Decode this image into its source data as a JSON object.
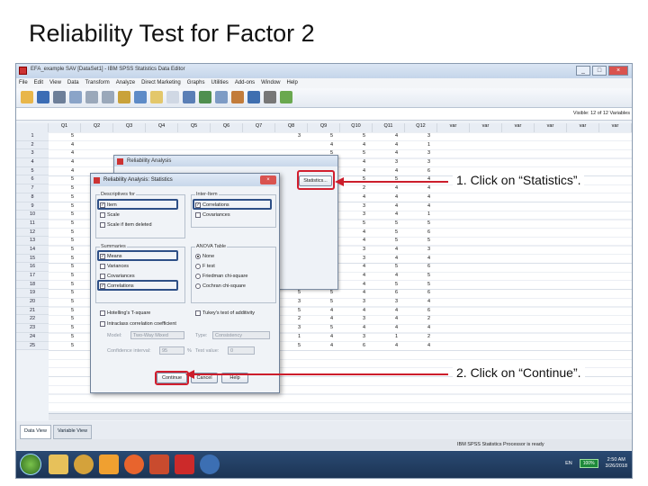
{
  "slide": {
    "title": "Reliability Test for Factor 2"
  },
  "window": {
    "title": "EFA_example SAV [DataSet1] - IBM SPSS Statistics Data Editor",
    "controls": [
      "_",
      "□",
      "×"
    ]
  },
  "menu": [
    "File",
    "Edit",
    "View",
    "Data",
    "Transform",
    "Analyze",
    "Direct Marketing",
    "Graphs",
    "Utilities",
    "Add-ons",
    "Window",
    "Help"
  ],
  "visible_vars": "Visible: 12 of 12 Variables",
  "columns": [
    "Q1",
    "Q2",
    "Q3",
    "Q4",
    "Q5",
    "Q6",
    "Q7",
    "Q8",
    "Q9",
    "Q10",
    "Q11",
    "Q12",
    "var",
    "var",
    "var",
    "var",
    "var",
    "var"
  ],
  "rows": [
    "1",
    "2",
    "3",
    "4",
    "5",
    "6",
    "7",
    "8",
    "9",
    "10",
    "11",
    "12",
    "13",
    "14",
    "15",
    "16",
    "17",
    "18",
    "19",
    "20",
    "21",
    "22",
    "23",
    "24",
    "25"
  ],
  "col_values": {
    "q1": [
      "5",
      "4",
      "4",
      "4",
      "4",
      "5",
      "5",
      "5",
      "5",
      "5",
      "5",
      "5",
      "5",
      "5",
      "5",
      "5",
      "5",
      "5",
      "5",
      "5",
      "5",
      "5",
      "5",
      "5",
      "5"
    ],
    "q9": [
      "5",
      "4",
      "5",
      "4",
      "4",
      "4",
      "5",
      "5",
      "5",
      "5",
      "5",
      "4",
      "5",
      "5",
      "5",
      "5",
      "4",
      "4",
      "5",
      "5",
      "4",
      "4",
      "5",
      "4",
      "4"
    ],
    "q10": [
      "5",
      "4",
      "5",
      "4",
      "4",
      "5",
      "2",
      "4",
      "3",
      "3",
      "5",
      "4",
      "4",
      "3",
      "3",
      "4",
      "4",
      "4",
      "4",
      "3",
      "4",
      "3",
      "4",
      "3",
      "6"
    ],
    "q11": [
      "4",
      "4",
      "4",
      "3",
      "4",
      "5",
      "4",
      "4",
      "4",
      "4",
      "5",
      "5",
      "5",
      "4",
      "4",
      "5",
      "4",
      "5",
      "6",
      "3",
      "4",
      "4",
      "4",
      "1",
      "4"
    ],
    "q12": [
      "3",
      "1",
      "3",
      "3",
      "6",
      "4",
      "4",
      "4",
      "4",
      "1",
      "5",
      "6",
      "5",
      "3",
      "4",
      "6",
      "5",
      "5",
      "6",
      "4",
      "6",
      "2",
      "4",
      "2",
      "4"
    ],
    "q8": [
      "3",
      "",
      "",
      "",
      "",
      "",
      "",
      "",
      "",
      "",
      "",
      "",
      "",
      "",
      "",
      "",
      "4",
      "4",
      "5",
      "3",
      "5",
      "2",
      "3",
      "1",
      "5"
    ]
  },
  "outer_dialog": {
    "title": "Reliability Analysis",
    "button_statistics": "Statistics..."
  },
  "stats_dialog": {
    "title": "Reliability Analysis: Statistics",
    "close": "×",
    "group_descriptives": "Descriptives for",
    "item": "Item",
    "scale": "Scale",
    "scale_if_deleted": "Scale if item deleted",
    "group_inter_item": "Inter-Item",
    "correlations": "Correlations",
    "covariances": "Covariances",
    "group_summaries": "Summaries",
    "means": "Means",
    "variances": "Variances",
    "summ_covariances": "Covariances",
    "summ_correlations": "Correlations",
    "group_anova": "ANOVA Table",
    "none": "None",
    "f_test": "F test",
    "friedman": "Friedman chi-square",
    "cochran": "Cochran chi-square",
    "hotelling": "Hotelling's T-square",
    "tukey": "Tukey's test of additivity",
    "intraclass": "Intraclass correlation coefficient",
    "model_label": "Model:",
    "model_value": "Two-Way Mixed",
    "type_label": "Type:",
    "type_value": "Consistency",
    "ci_label": "Confidence interval:",
    "ci_value": "95",
    "ci_unit": "%",
    "test_label": "Test value:",
    "test_value": "0",
    "continue": "Continue",
    "cancel": "Cancel",
    "help": "Help"
  },
  "tabs": {
    "data_view": "Data View",
    "variable_view": "Variable View"
  },
  "status": "IBM SPSS Statistics Processor is ready",
  "taskbar": {
    "lang": "EN",
    "zoom": "100%",
    "time": "2:50 AM",
    "date": "3/26/2018"
  },
  "annotations": {
    "a1": "1. Click on “Statistics”.",
    "a2": "2. Click on “Continue”."
  },
  "colors": {
    "highlight_red": "#d21e2e",
    "highlight_blue": "#2e4f86",
    "arrow": "#cc1d2b"
  }
}
